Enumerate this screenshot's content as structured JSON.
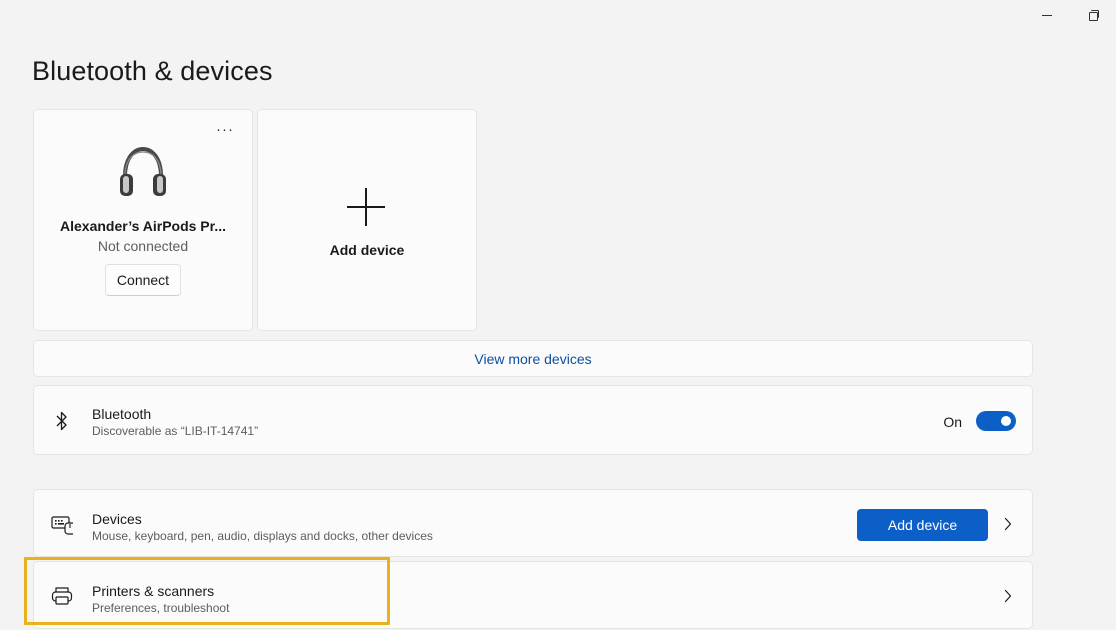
{
  "window": {
    "minimize_icon": "minimize-icon",
    "restore_icon": "restore-icon"
  },
  "page": {
    "title": "Bluetooth & devices"
  },
  "device_tile": {
    "name": "Alexander’s AirPods Pr...",
    "status": "Not connected",
    "connect_label": "Connect",
    "more_label": "···",
    "icon": "headphones-icon"
  },
  "add_tile": {
    "label": "Add device",
    "icon": "plus-icon"
  },
  "view_more": {
    "label": "View more devices"
  },
  "bluetooth": {
    "title": "Bluetooth",
    "subtitle": "Discoverable as “LIB-IT-14741”",
    "state_label": "On",
    "enabled": true,
    "icon": "bluetooth-icon"
  },
  "devices": {
    "title": "Devices",
    "subtitle": "Mouse, keyboard, pen, audio, displays and docks, other devices",
    "button_label": "Add device",
    "icon": "devices-icon"
  },
  "printers": {
    "title": "Printers & scanners",
    "subtitle": "Preferences, troubleshoot",
    "icon": "printer-icon"
  },
  "colors": {
    "accent": "#0c5fc7",
    "link": "#0a4f9e",
    "highlight": "#e8b21e",
    "background": "#f3f3f3",
    "card": "#fbfbfb"
  }
}
